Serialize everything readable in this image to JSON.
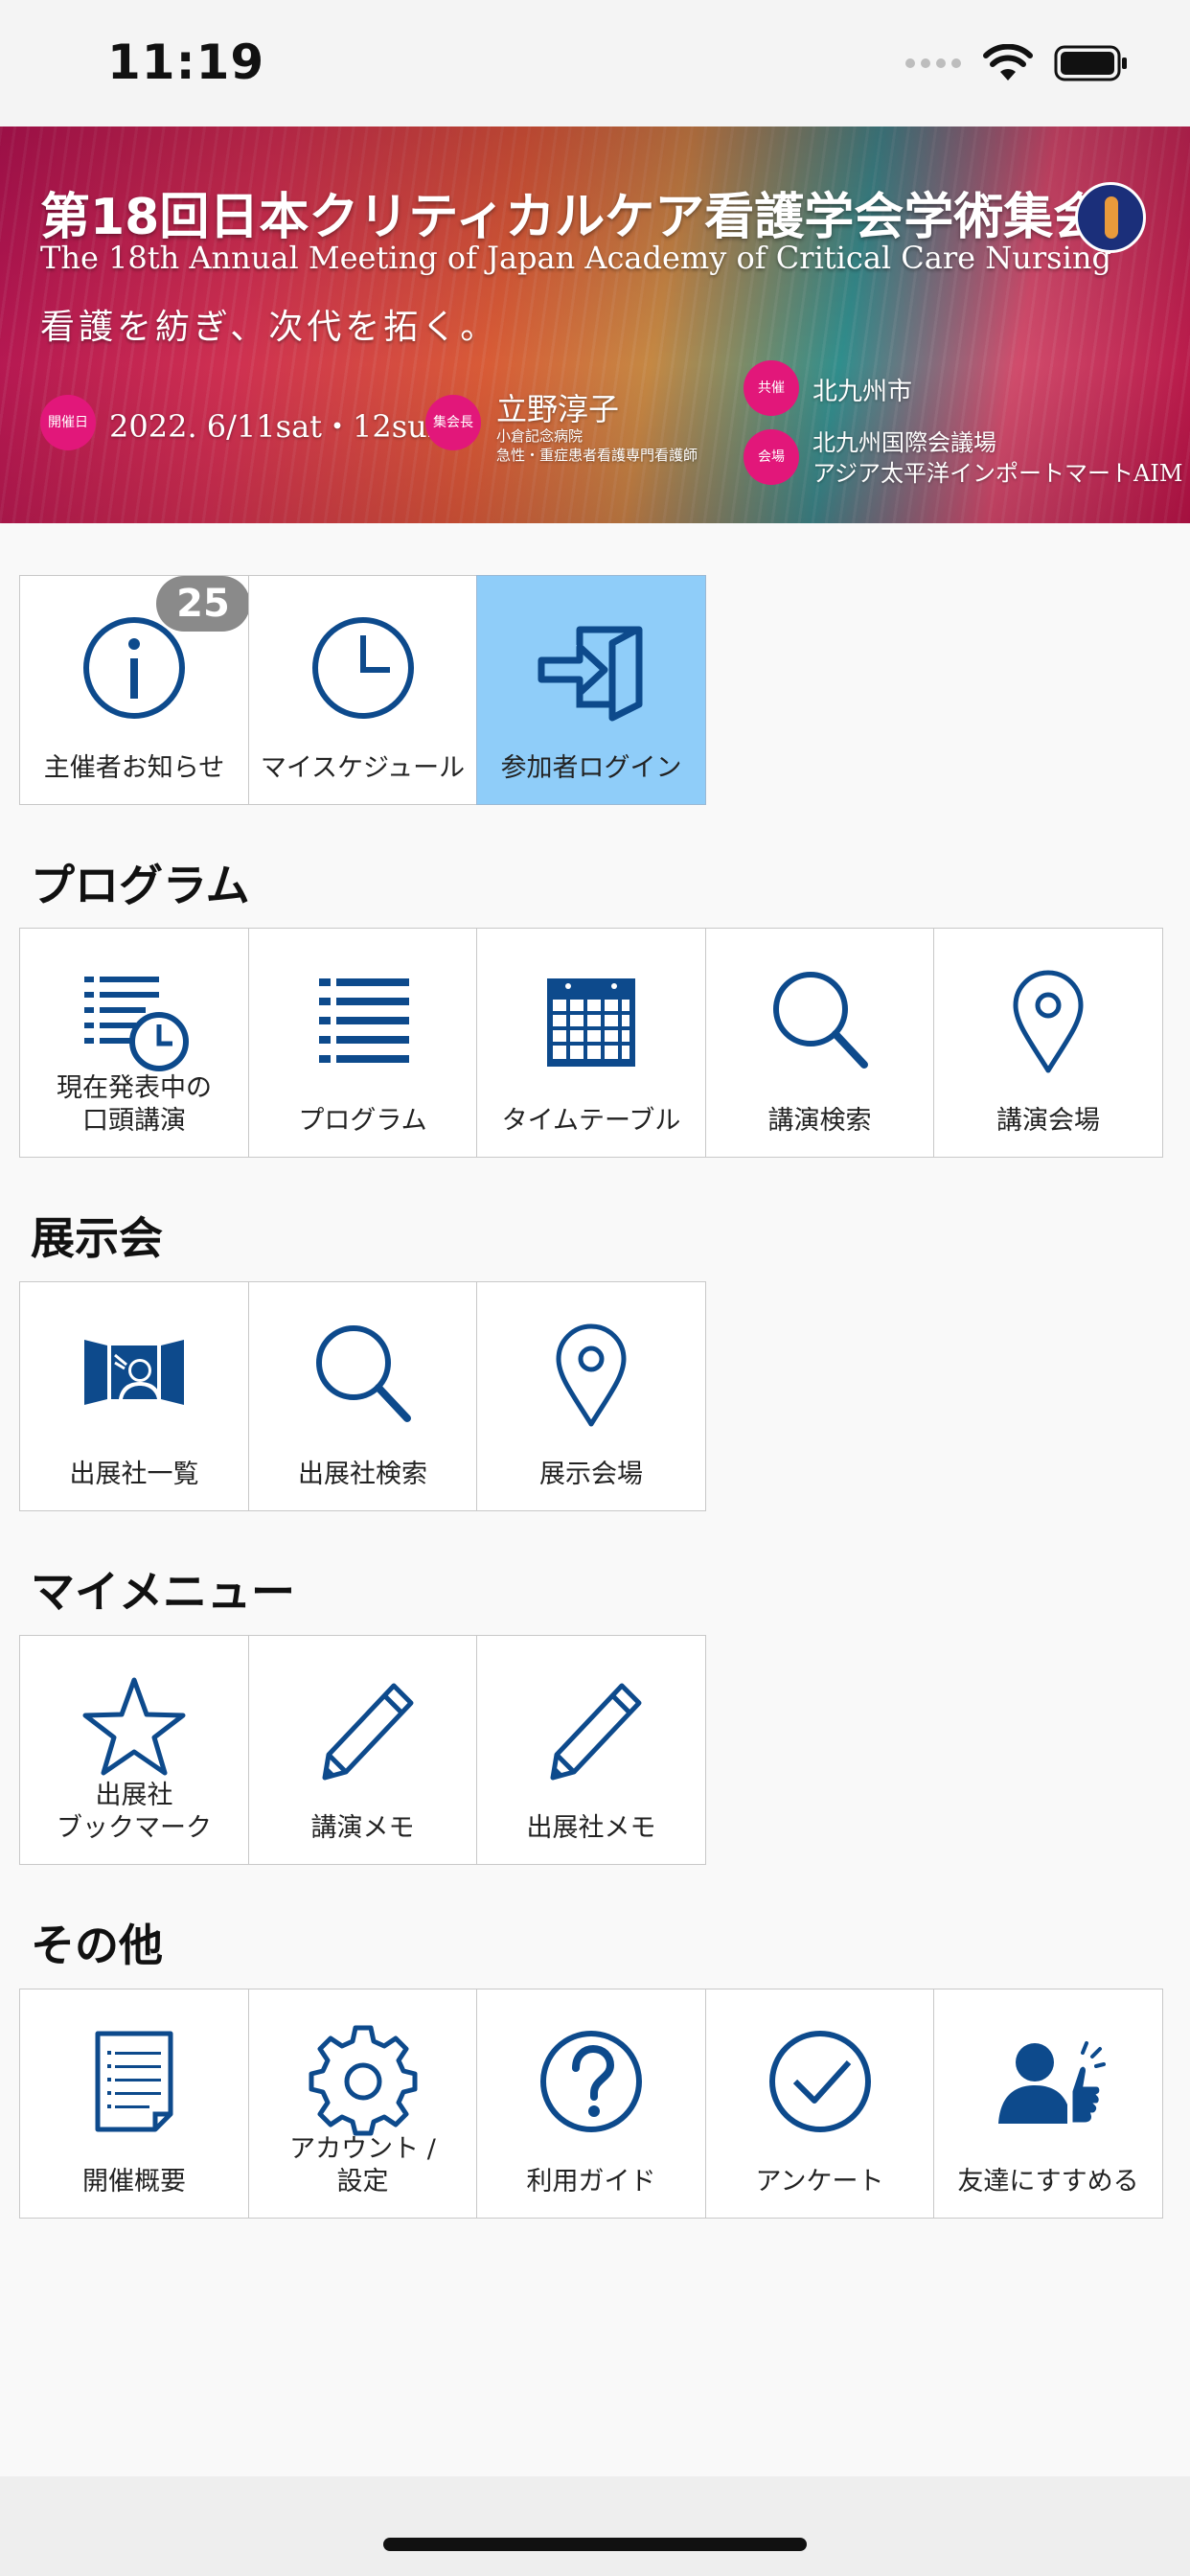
{
  "status_bar": {
    "time": "11:19"
  },
  "banner": {
    "title_jp": "第18回日本クリティカルケア看護学会学術集会",
    "title_en": "The 18th Annual Meeting of Japan Academy of Critical Care Nursing",
    "slogan": "看護を紡ぎ、次代を拓く。",
    "date_tag": "開催日",
    "date": "2022. 6/11sat・12sun",
    "chair_tag": "集会長",
    "chair_name": "立野淳子",
    "chair_affil1": "小倉記念病院",
    "chair_affil2": "急性・重症患者看護専門看護師",
    "cohost_tag": "共催",
    "cohost": "北九州市",
    "venue_tag": "会場",
    "venue1": "北九州国際会議場",
    "venue2": "アジア太平洋インポートマートAIM"
  },
  "top_menu": {
    "notice": {
      "label": "主催者お知らせ",
      "badge": "25",
      "icon": "info-icon"
    },
    "schedule": {
      "label": "マイスケジュール",
      "icon": "clock-icon"
    },
    "login": {
      "label": "参加者ログイン",
      "icon": "login-icon"
    }
  },
  "sections": {
    "program": {
      "title": "プログラム",
      "items": [
        {
          "label": "現在発表中の\n口頭講演",
          "icon": "list-clock-icon"
        },
        {
          "label": "プログラム",
          "icon": "list-icon"
        },
        {
          "label": "タイムテーブル",
          "icon": "calendar-icon"
        },
        {
          "label": "講演検索",
          "icon": "search-icon"
        },
        {
          "label": "講演会場",
          "icon": "map-pin-icon"
        }
      ]
    },
    "exhibition": {
      "title": "展示会",
      "items": [
        {
          "label": "出展社一覧",
          "icon": "presenter-icon"
        },
        {
          "label": "出展社検索",
          "icon": "search-icon"
        },
        {
          "label": "展示会場",
          "icon": "map-pin-icon"
        }
      ]
    },
    "mymenu": {
      "title": "マイメニュー",
      "items": [
        {
          "label": "出展社\nブックマーク",
          "icon": "star-icon"
        },
        {
          "label": "講演メモ",
          "icon": "pencil-icon"
        },
        {
          "label": "出展社メモ",
          "icon": "pencil-icon"
        }
      ]
    },
    "other": {
      "title": "その他",
      "items": [
        {
          "label": "開催概要",
          "icon": "document-icon"
        },
        {
          "label": "アカウント /\n設定",
          "icon": "gear-icon"
        },
        {
          "label": "利用ガイド",
          "icon": "help-icon"
        },
        {
          "label": "アンケート",
          "icon": "check-circle-icon"
        },
        {
          "label": "友達にすすめる",
          "icon": "recommend-icon"
        }
      ]
    }
  },
  "colors": {
    "icon": "#0d4a8c",
    "active_tile": "#8fcdf9",
    "badge": "#8a8a8a",
    "banner_tag": "#e2177a"
  }
}
